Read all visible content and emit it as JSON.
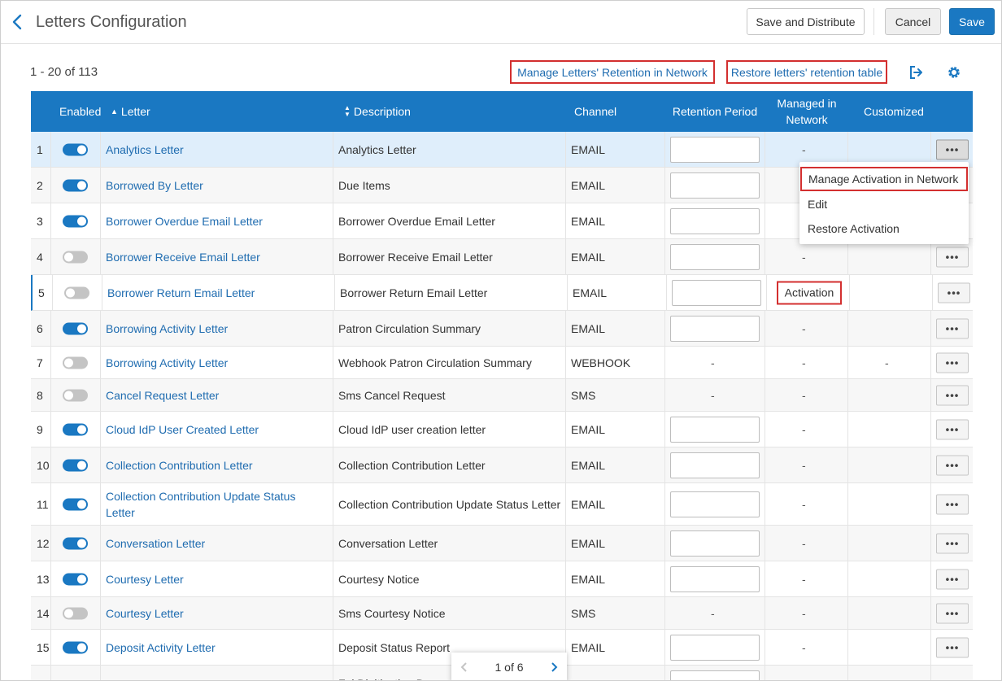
{
  "header": {
    "title": "Letters Configuration",
    "save_distribute_label": "Save and Distribute",
    "cancel_label": "Cancel",
    "save_label": "Save"
  },
  "toolbar": {
    "count": "1 - 20 of 113",
    "manage_retention_label": "Manage Letters' Retention in Network",
    "restore_retention_label": "Restore letters' retention table",
    "export_icon": "export-icon",
    "settings_icon": "gear-icon"
  },
  "table": {
    "headers": {
      "enabled": "Enabled",
      "letter": "Letter",
      "description": "Description",
      "channel": "Channel",
      "retention": "Retention Period",
      "managed_line1": "Managed in",
      "managed_line2": "Network",
      "customized": "Customized"
    },
    "dash": "-",
    "more_label": "•••",
    "rows": [
      {
        "num": "1",
        "enabled": true,
        "letter": "Analytics Letter",
        "description": "Analytics Letter",
        "channel": "EMAIL",
        "retention": "input",
        "managed": "-",
        "customized": ""
      },
      {
        "num": "2",
        "enabled": true,
        "letter": "Borrowed By Letter",
        "description": "Due Items",
        "channel": "EMAIL",
        "retention": "input",
        "managed": "",
        "customized": ""
      },
      {
        "num": "3",
        "enabled": true,
        "letter": "Borrower Overdue Email Letter",
        "description": "Borrower Overdue Email Letter",
        "channel": "EMAIL",
        "retention": "input",
        "managed": "",
        "customized": ""
      },
      {
        "num": "4",
        "enabled": false,
        "letter": "Borrower Receive Email Letter",
        "description": "Borrower Receive Email Letter",
        "channel": "EMAIL",
        "retention": "input",
        "managed": "-",
        "customized": ""
      },
      {
        "num": "5",
        "enabled": false,
        "letter": "Borrower Return Email Letter",
        "description": "Borrower Return Email Letter",
        "channel": "EMAIL",
        "retention": "input",
        "managed": "Activation",
        "customized": ""
      },
      {
        "num": "6",
        "enabled": true,
        "letter": "Borrowing Activity Letter",
        "description": "Patron Circulation Summary",
        "channel": "EMAIL",
        "retention": "input",
        "managed": "-",
        "customized": ""
      },
      {
        "num": "7",
        "enabled": false,
        "letter": "Borrowing Activity Letter",
        "description": "Webhook Patron Circulation Summary",
        "channel": "WEBHOOK",
        "retention": "-",
        "managed": "-",
        "customized": "-"
      },
      {
        "num": "8",
        "enabled": false,
        "letter": "Cancel Request Letter",
        "description": "Sms Cancel Request",
        "channel": "SMS",
        "retention": "-",
        "managed": "-",
        "customized": ""
      },
      {
        "num": "9",
        "enabled": true,
        "letter": "Cloud IdP User Created Letter",
        "description": "Cloud IdP user creation letter",
        "channel": "EMAIL",
        "retention": "input",
        "managed": "-",
        "customized": ""
      },
      {
        "num": "10",
        "enabled": true,
        "letter": "Collection Contribution Letter",
        "description": "Collection Contribution Letter",
        "channel": "EMAIL",
        "retention": "input",
        "managed": "-",
        "customized": ""
      },
      {
        "num": "11",
        "enabled": true,
        "letter": "Collection Contribution Update Status Letter",
        "description": "Collection Contribution Update Status Letter",
        "channel": "EMAIL",
        "retention": "input",
        "managed": "-",
        "customized": ""
      },
      {
        "num": "12",
        "enabled": true,
        "letter": "Conversation Letter",
        "description": "Conversation Letter",
        "channel": "EMAIL",
        "retention": "input",
        "managed": "-",
        "customized": ""
      },
      {
        "num": "13",
        "enabled": true,
        "letter": "Courtesy Letter",
        "description": "Courtesy Notice",
        "channel": "EMAIL",
        "retention": "input",
        "managed": "-",
        "customized": ""
      },
      {
        "num": "14",
        "enabled": false,
        "letter": "Courtesy Letter",
        "description": "Sms Courtesy Notice",
        "channel": "SMS",
        "retention": "-",
        "managed": "-",
        "customized": ""
      },
      {
        "num": "15",
        "enabled": true,
        "letter": "Deposit Activity Letter",
        "description": "Deposit Status Report",
        "channel": "EMAIL",
        "retention": "input",
        "managed": "-",
        "customized": ""
      },
      {
        "num": "",
        "enabled": null,
        "letter": "",
        "description": "Ful Digitization Docum",
        "channel": "",
        "retention": "input",
        "managed": "",
        "customized": ""
      }
    ]
  },
  "menu": {
    "items": [
      "Manage Activation in Network",
      "Edit",
      "Restore Activation"
    ]
  },
  "pager": {
    "text": "1 of 6"
  },
  "colors": {
    "primary": "#1a78c2",
    "link": "#1f6cb0",
    "highlight": "#d32f2f"
  }
}
